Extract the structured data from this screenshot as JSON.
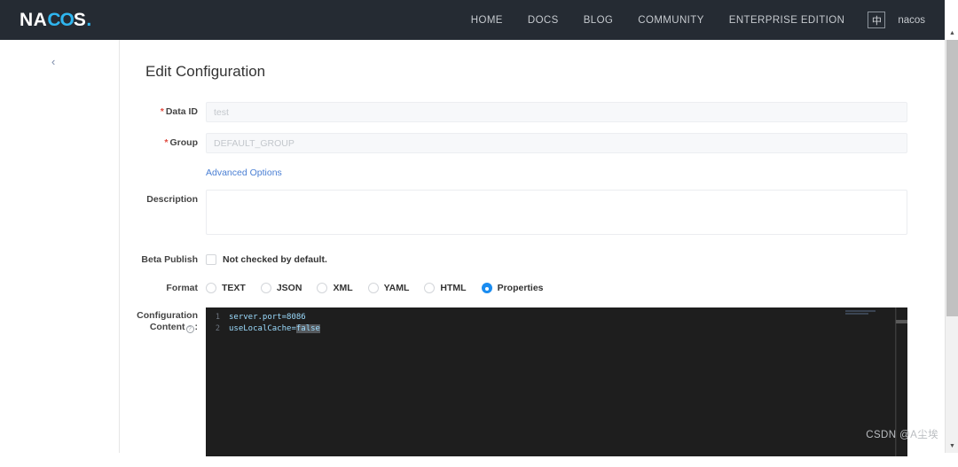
{
  "header": {
    "brand": {
      "pre": "NA",
      "mid": "CO",
      "post": "S",
      "dot": "."
    },
    "nav": [
      {
        "label": "HOME"
      },
      {
        "label": "DOCS"
      },
      {
        "label": "BLOG"
      },
      {
        "label": "COMMUNITY"
      },
      {
        "label": "ENTERPRISE EDITION"
      }
    ],
    "language_toggle": "中",
    "username": "nacos"
  },
  "sidebar": {
    "collapse_icon": "‹"
  },
  "page": {
    "title": "Edit Configuration"
  },
  "form": {
    "data_id": {
      "label": "Data ID",
      "required_mark": "*",
      "value": "test"
    },
    "group": {
      "label": "Group",
      "required_mark": "*",
      "value": "DEFAULT_GROUP"
    },
    "advanced_options": "Advanced Options",
    "description": {
      "label": "Description",
      "value": "",
      "placeholder": ""
    },
    "beta_publish": {
      "label": "Beta Publish",
      "checkbox_text": "Not checked by default.",
      "checked": false
    },
    "format": {
      "label": "Format",
      "options": [
        {
          "label": "TEXT",
          "selected": false
        },
        {
          "label": "JSON",
          "selected": false
        },
        {
          "label": "XML",
          "selected": false
        },
        {
          "label": "YAML",
          "selected": false
        },
        {
          "label": "HTML",
          "selected": false
        },
        {
          "label": "Properties",
          "selected": true
        }
      ],
      "selected": "Properties",
      "accent_color": "#1a8cf0"
    },
    "configuration_content": {
      "label_line1": "Configuration",
      "label_line2_pre": "Content",
      "label_line2_post": ":",
      "help_icon": "?",
      "lines": [
        {
          "number": "1",
          "text": "server.port=8086",
          "selection": ""
        },
        {
          "number": "2",
          "text": "useLocalCache=",
          "selection": "false"
        }
      ]
    }
  },
  "watermark": "CSDN @A尘埃"
}
